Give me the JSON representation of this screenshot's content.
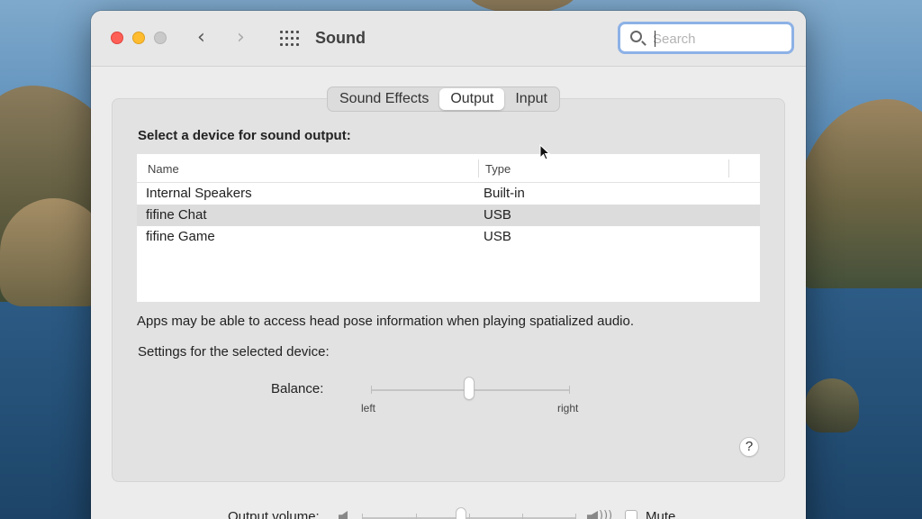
{
  "window": {
    "title": "Sound"
  },
  "toolbar": {
    "back_icon": "chevron-left-icon",
    "forward_icon": "chevron-right-icon",
    "grid_icon": "show-all-grid-icon"
  },
  "search": {
    "placeholder": "Search",
    "value": ""
  },
  "tabs": [
    {
      "label": "Sound Effects",
      "active": false
    },
    {
      "label": "Output",
      "active": true
    },
    {
      "label": "Input",
      "active": false
    }
  ],
  "output": {
    "section_title": "Select a device for sound output:",
    "columns": [
      "Name",
      "Type"
    ],
    "devices": [
      {
        "name": "Internal Speakers",
        "type": "Built-in",
        "selected": false
      },
      {
        "name": "fifine Chat",
        "type": "USB",
        "selected": true
      },
      {
        "name": "fifine Game",
        "type": "USB",
        "selected": false
      }
    ],
    "note": "Apps may be able to access head pose information when playing spatialized audio.",
    "settings_label": "Settings for the selected device:",
    "balance": {
      "label": "Balance:",
      "left_label": "left",
      "right_label": "right",
      "value": 0.5
    },
    "help_label": "?"
  },
  "volume": {
    "label": "Output volume:",
    "value": 0.45,
    "mute_label": "Mute",
    "muted": false
  },
  "colors": {
    "close": "#fe5f57",
    "minimize": "#febc2e",
    "zoom": "#c9c9c9",
    "search_focus": "#8db1e6",
    "selected_row": "#dcdcdc"
  }
}
